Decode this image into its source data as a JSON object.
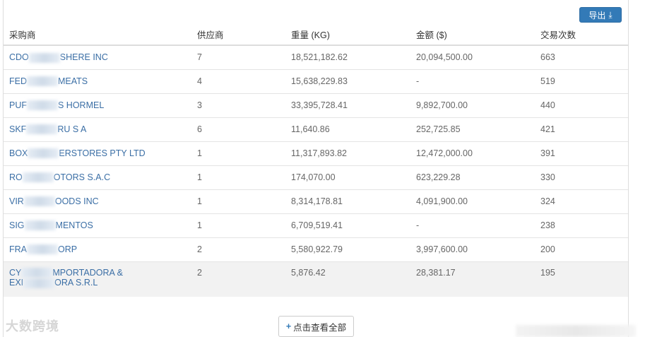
{
  "toolbar": {
    "export_label": "导出",
    "export_icon": "download-icon"
  },
  "table": {
    "headers": [
      "采购商",
      "供应商",
      "重量 (KG)",
      "金额 ($)",
      "交易次数"
    ],
    "rows": [
      {
        "name_a": "CDO",
        "name_b": "SHERE INC",
        "suppliers": "7",
        "weight": "18,521,182.62",
        "amount": "20,094,500.00",
        "count": "663"
      },
      {
        "name_a": "FED",
        "name_b": "MEATS",
        "suppliers": "4",
        "weight": "15,638,229.83",
        "amount": "-",
        "count": "519"
      },
      {
        "name_a": "PUF",
        "name_b": "S HORMEL",
        "suppliers": "3",
        "weight": "33,395,728.41",
        "amount": "9,892,700.00",
        "count": "440"
      },
      {
        "name_a": "SKF",
        "name_b": "RU S A",
        "suppliers": "6",
        "weight": "11,640.86",
        "amount": "252,725.85",
        "count": "421"
      },
      {
        "name_a": "BOX",
        "name_b": "ERSTORES PTY LTD",
        "suppliers": "1",
        "weight": "11,317,893.82",
        "amount": "12,472,000.00",
        "count": "391"
      },
      {
        "name_a": "RO",
        "name_b": "OTORS S.A.C",
        "suppliers": "1",
        "weight": "174,070.00",
        "amount": "623,229.28",
        "count": "330"
      },
      {
        "name_a": "VIR",
        "name_b": "OODS INC",
        "suppliers": "1",
        "weight": "8,314,178.81",
        "amount": "4,091,900.00",
        "count": "324"
      },
      {
        "name_a": "SIG",
        "name_b": "MENTOS",
        "suppliers": "1",
        "weight": "6,709,519.41",
        "amount": "-",
        "count": "238"
      },
      {
        "name_a": "FRA",
        "name_b": "ORP",
        "suppliers": "2",
        "weight": "5,580,922.79",
        "amount": "3,997,600.00",
        "count": "200"
      },
      {
        "name_a": "CY",
        "name_b": "MPORTADORA &",
        "name_c": "EXI",
        "name_d": "ORA S.R.L",
        "suppliers": "2",
        "weight": "5,876.42",
        "amount": "28,381.17",
        "count": "195"
      }
    ]
  },
  "footer": {
    "view_all_label": "点击查看全部",
    "watermark": "大数跨境"
  }
}
